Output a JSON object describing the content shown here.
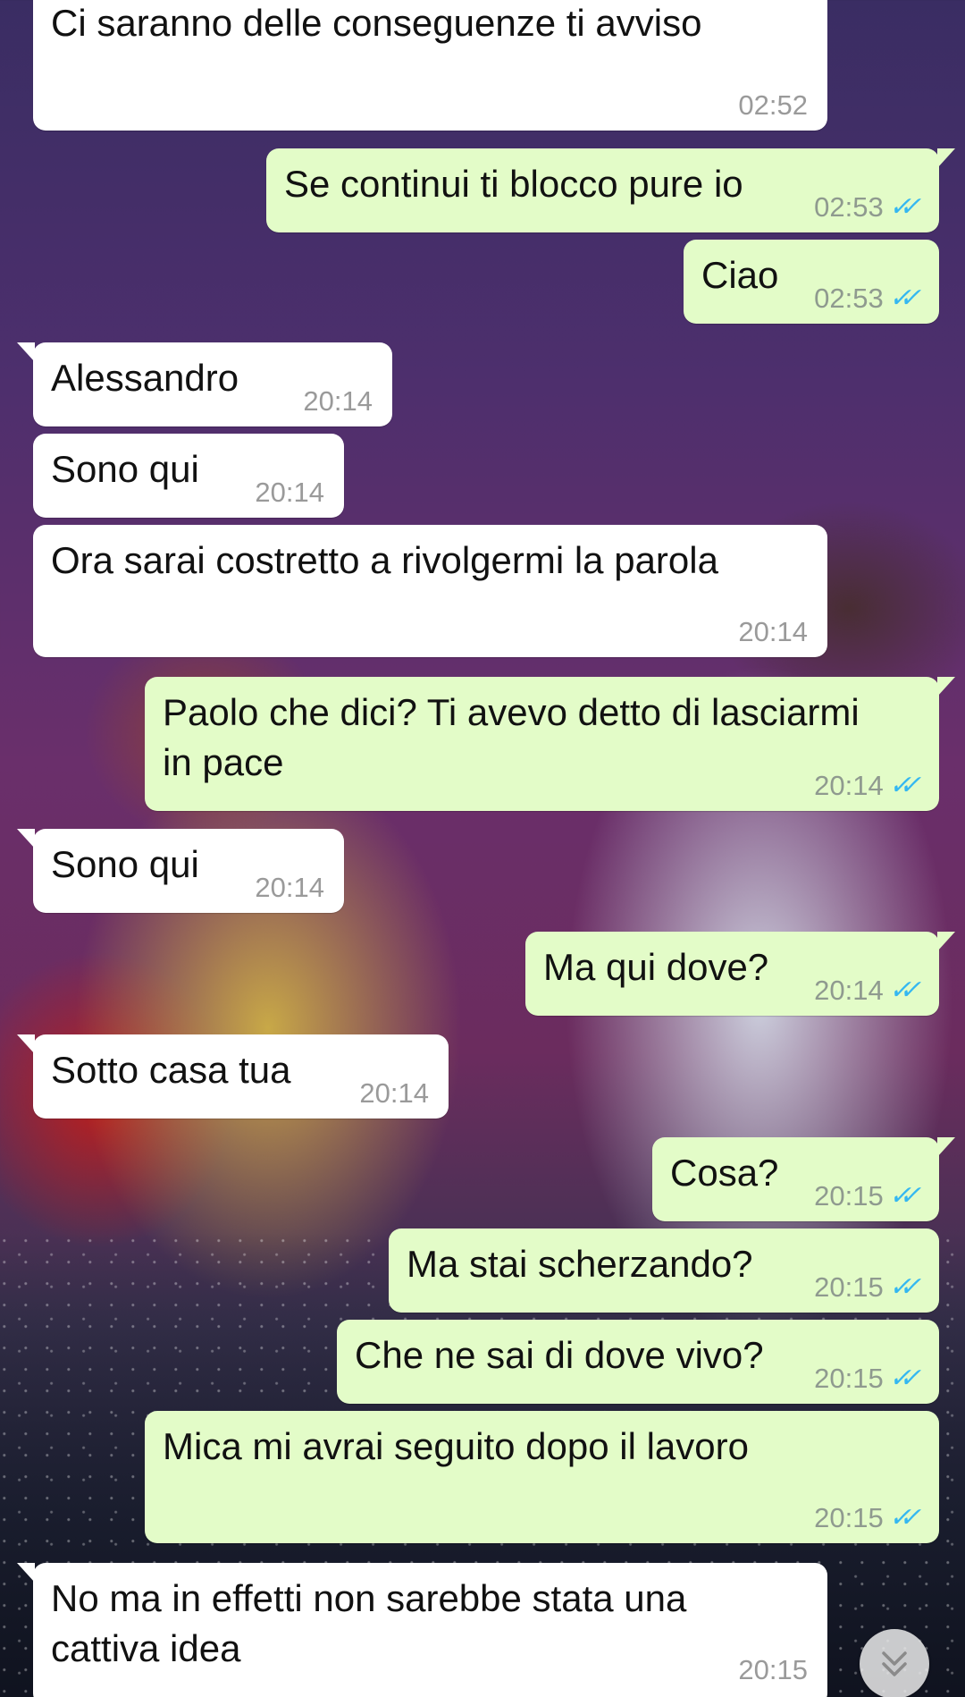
{
  "messages": [
    {
      "text": "Ci saranno delle conseguenze ti avviso",
      "time": "02:52"
    },
    {
      "text": "Se continui ti blocco pure io",
      "time": "02:53"
    },
    {
      "text": "Ciao",
      "time": "02:53"
    },
    {
      "text": "Alessandro",
      "time": "20:14"
    },
    {
      "text": "Sono qui",
      "time": "20:14"
    },
    {
      "text": "Ora sarai costretto a rivolgermi la parola",
      "time": "20:14"
    },
    {
      "text": "Paolo che dici? Ti avevo detto di lasciarmi\nin pace",
      "time": "20:14"
    },
    {
      "text": "Sono qui",
      "time": "20:14"
    },
    {
      "text": "Ma qui dove?",
      "time": "20:14"
    },
    {
      "text": "Sotto casa tua",
      "time": "20:14"
    },
    {
      "text": "Cosa?",
      "time": "20:15"
    },
    {
      "text": "Ma stai scherzando?",
      "time": "20:15"
    },
    {
      "text": "Che ne sai di dove vivo?",
      "time": "20:15"
    },
    {
      "text": "Mica mi avrai seguito dopo il lavoro",
      "time": "20:15"
    },
    {
      "text": "No ma in effetti non sarebbe stata una\ncattiva idea",
      "time": "20:15"
    }
  ],
  "read_receipt_icon": "double-check-icon",
  "scroll_button_icon": "chevron-double-down-icon",
  "colors": {
    "incoming_bubble": "#ffffff",
    "outgoing_bubble": "#e3fcc8",
    "read_ticks": "#34b7f1"
  }
}
